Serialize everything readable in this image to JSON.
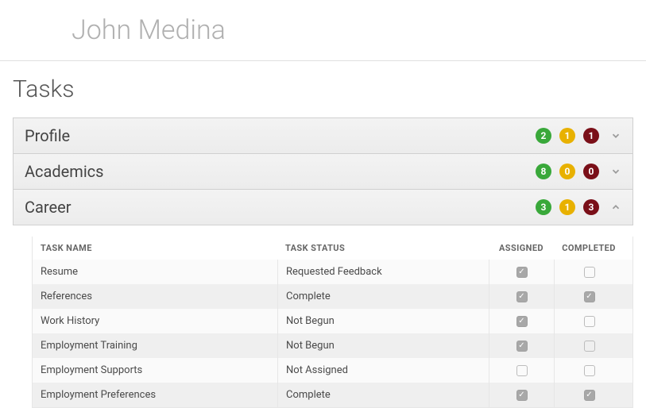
{
  "page_title": "John Medina",
  "section_heading": "Tasks",
  "columns": {
    "name": "TASK NAME",
    "status": "TASK STATUS",
    "assigned": "ASSIGNED",
    "completed": "COMPLETED"
  },
  "accordions": [
    {
      "title": "Profile",
      "expanded": false,
      "counts": {
        "green": 2,
        "amber": 1,
        "red": 1
      }
    },
    {
      "title": "Academics",
      "expanded": false,
      "counts": {
        "green": 8,
        "amber": 0,
        "red": 0
      }
    },
    {
      "title": "Career",
      "expanded": true,
      "counts": {
        "green": 3,
        "amber": 1,
        "red": 3
      },
      "tasks": [
        {
          "name": "Resume",
          "status": "Requested Feedback",
          "assigned": true,
          "completed": false
        },
        {
          "name": "References",
          "status": "Complete",
          "assigned": true,
          "completed": true
        },
        {
          "name": "Work History",
          "status": "Not Begun",
          "assigned": true,
          "completed": false
        },
        {
          "name": "Employment Training",
          "status": "Not Begun",
          "assigned": true,
          "completed": false
        },
        {
          "name": "Employment Supports",
          "status": "Not Assigned",
          "assigned": false,
          "completed": false
        },
        {
          "name": "Employment Preferences",
          "status": "Complete",
          "assigned": true,
          "completed": true
        }
      ]
    }
  ]
}
